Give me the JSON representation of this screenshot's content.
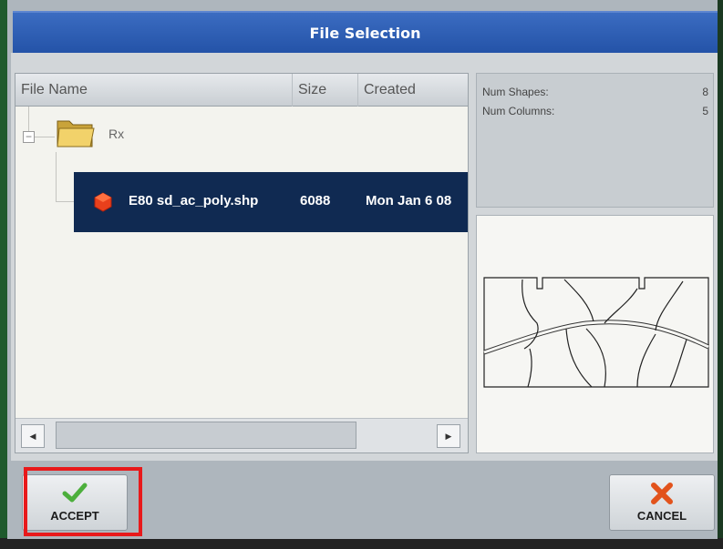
{
  "window": {
    "title": "File Selection"
  },
  "table": {
    "columns": [
      "File Name",
      "Size",
      "Created"
    ],
    "folder": {
      "name": "Rx",
      "expander": "−"
    },
    "rows": [
      {
        "name": "E80 sd_ac_poly.shp",
        "size": "6088",
        "created": "Mon Jan 6 08"
      }
    ]
  },
  "info": {
    "num_shapes_label": "Num Shapes:",
    "num_shapes_value": "8",
    "num_columns_label": "Num Columns:",
    "num_columns_value": "5"
  },
  "buttons": {
    "accept_label": "ACCEPT",
    "cancel_label": "CANCEL"
  },
  "icons": {
    "folder": "folder-icon",
    "shapefile": "shapefile-icon",
    "accept": "checkmark-icon",
    "cancel": "x-icon"
  },
  "colors": {
    "title_bar": "#2d5cb4",
    "selected_row": "#102a52",
    "accept_check": "#4caf3c",
    "cancel_x": "#e2531c",
    "highlight": "#e8191b"
  }
}
